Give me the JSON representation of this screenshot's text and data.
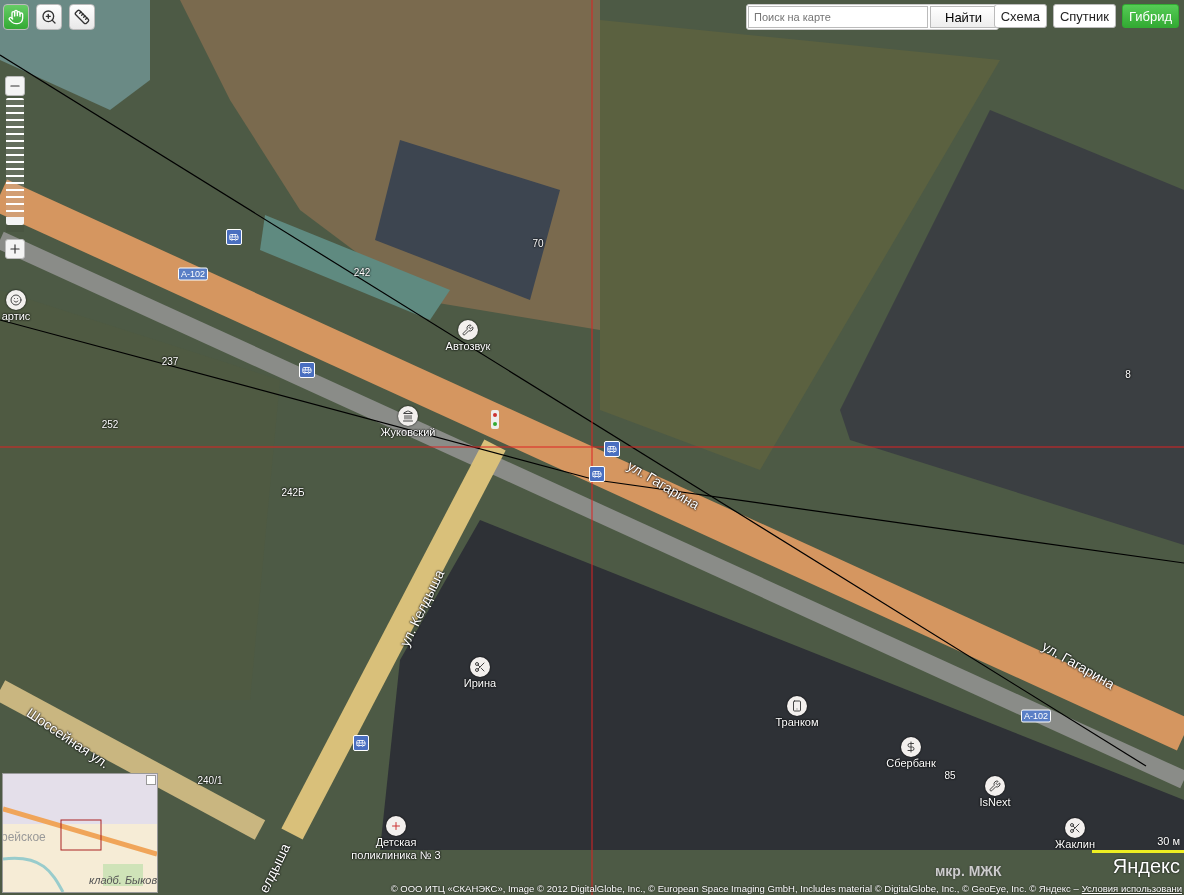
{
  "tools": [
    {
      "kind": "hand",
      "selected": true
    },
    {
      "kind": "zoom-area",
      "selected": false
    },
    {
      "kind": "ruler",
      "selected": false
    }
  ],
  "zoom": {
    "level": 0.95
  },
  "search": {
    "placeholder": "Поиск на карте",
    "button": "Найти"
  },
  "map_types": [
    {
      "label": "Схема",
      "selected": false
    },
    {
      "label": "Спутник",
      "selected": false
    },
    {
      "label": "Гибрид",
      "selected": true
    }
  ],
  "pois": [
    {
      "label": "Автозвук",
      "kind": "repair"
    },
    {
      "label": "Жуковский",
      "kind": "monument"
    },
    {
      "label": "Ирина",
      "kind": "hairdresser"
    },
    {
      "label": "Транком",
      "kind": "phone"
    },
    {
      "label": "Сбербанк",
      "kind": "bank"
    },
    {
      "label": "IsNext",
      "kind": "repair"
    },
    {
      "label": "Жаклин",
      "kind": "hairdresser"
    },
    {
      "label": "Детская поликлиника № 3",
      "kind": "clinic"
    },
    {
      "label": "артис",
      "kind": "dentist"
    }
  ],
  "house_numbers": [
    "70",
    "242",
    "237",
    "252",
    "242Б",
    "8",
    "85",
    "240/1"
  ],
  "streets": [
    "ул. Гагарина",
    "ул. Гагарина",
    "ул. Келдыша",
    "Шоссейная ул.",
    "елдыша"
  ],
  "district": "мкр. МЖК",
  "road_signs": [
    "А-102",
    "А-102"
  ],
  "minimap": {
    "labels": [
      "рейское",
      "кладб. Быков"
    ]
  },
  "scale": "30 м",
  "logo": "Яндекс",
  "copyright": {
    "text": "© ООО ИТЦ «СКАНЭКС», Image © 2012 DigitalGlobe, Inc., © European Space Imaging GmbH, Includes material © DigitalGlobe, Inc., © GeoEye, Inc. © Яндекс –",
    "link": "Условия использовани"
  }
}
